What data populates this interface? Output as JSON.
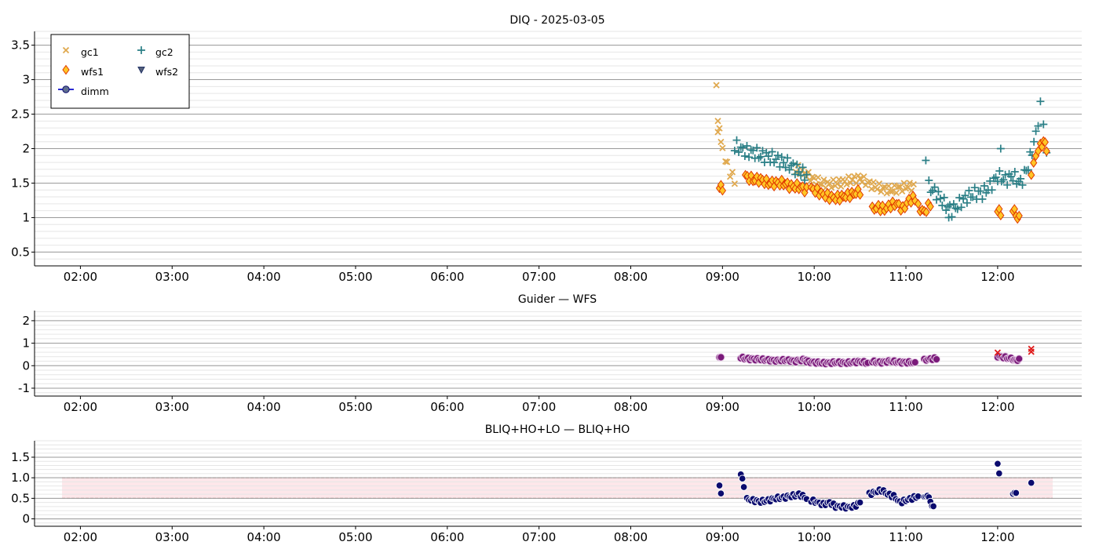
{
  "figure": {
    "colors": {
      "gc1": "#e0a94f",
      "gc2": "#2a7f86",
      "wfs1_fill": "#ffc626",
      "wfs1_edge": "#e03a00",
      "wfs2": "#223366",
      "dimm": "#0b0b6e",
      "guider": "#7a1a7a",
      "guider_alert": "#e01b1b",
      "band": "#fde7ea",
      "band_line": "#a31414"
    }
  },
  "chart_data": [
    {
      "type": "scatter",
      "title": "DIQ - 2025-03-05",
      "x_ticks": [
        "02:00",
        "03:00",
        "04:00",
        "05:00",
        "06:00",
        "07:00",
        "08:00",
        "09:00",
        "10:00",
        "11:00",
        "12:00"
      ],
      "y_ticks": [
        "0.5",
        "1",
        "1.5",
        "2",
        "2.5",
        "3",
        "3.5"
      ],
      "xlim": [
        "01:30",
        "12:55"
      ],
      "ylim": [
        0.3,
        3.7
      ],
      "grid": true,
      "legend": {
        "placement": "top-left",
        "entries": [
          "gc1",
          "gc2",
          "wfs1",
          "wfs2",
          "dimm"
        ]
      },
      "series": [
        {
          "name": "gc1",
          "marker": "x",
          "segments": [
            {
              "x": [
                "08:57",
                "08:58",
                "08:59",
                "09:00",
                "09:02",
                "09:03",
                "09:05",
                "09:08"
              ],
              "y": [
                2.2,
                2.35,
                2.1,
                1.95,
                1.85,
                1.75,
                1.65,
                1.55
              ]
            },
            {
              "x": [
                "09:48",
                "09:55",
                "10:00",
                "10:05",
                "10:10",
                "10:15",
                "10:20",
                "10:25",
                "10:30",
                "10:35",
                "10:40",
                "10:45",
                "10:50",
                "10:55",
                "11:00",
                "11:05"
              ],
              "y": [
                1.72,
                1.62,
                1.55,
                1.5,
                1.48,
                1.5,
                1.52,
                1.55,
                1.57,
                1.5,
                1.45,
                1.42,
                1.4,
                1.42,
                1.45,
                1.45
              ]
            }
          ],
          "points": [
            {
              "x": "08:56",
              "y": 2.92
            },
            {
              "x": "08:57",
              "y": 2.4
            }
          ]
        },
        {
          "name": "gc2",
          "marker": "+",
          "segments": [
            {
              "x": [
                "09:08",
                "09:12",
                "09:16",
                "09:20",
                "09:25",
                "09:30",
                "09:35",
                "09:40",
                "09:45",
                "09:50",
                "09:55"
              ],
              "y": [
                2.05,
                2.0,
                1.95,
                1.95,
                1.9,
                1.88,
                1.85,
                1.8,
                1.75,
                1.68,
                1.6
              ]
            },
            {
              "x": [
                "11:15",
                "11:20",
                "11:25",
                "11:30",
                "11:35",
                "11:40",
                "11:45",
                "11:50",
                "11:55",
                "12:00",
                "12:05",
                "12:10",
                "12:15",
                "12:20",
                "12:25",
                "12:28",
                "12:30",
                "12:32"
              ],
              "y": [
                1.45,
                1.35,
                1.2,
                1.1,
                1.2,
                1.3,
                1.35,
                1.35,
                1.45,
                1.6,
                1.55,
                1.6,
                1.5,
                1.75,
                2.2,
                2.6,
                2.4,
                1.95
              ]
            }
          ],
          "points": [
            {
              "x": "11:13",
              "y": 1.83
            },
            {
              "x": "12:02",
              "y": 2.0
            },
            {
              "x": "11:28",
              "y": 1.0
            }
          ]
        },
        {
          "name": "wfs1",
          "marker": "diamond",
          "segments": [
            {
              "x": [
                "08:58",
                "09:00"
              ],
              "y": [
                1.45,
                1.4
              ]
            },
            {
              "x": [
                "09:15",
                "09:20",
                "09:25",
                "09:30",
                "09:35",
                "09:40",
                "09:45",
                "09:50",
                "09:55"
              ],
              "y": [
                1.6,
                1.55,
                1.55,
                1.5,
                1.5,
                1.5,
                1.45,
                1.45,
                1.4
              ]
            },
            {
              "x": [
                "09:58",
                "10:02",
                "10:06",
                "10:10",
                "10:14",
                "10:18",
                "10:22",
                "10:26",
                "10:30"
              ],
              "y": [
                1.42,
                1.38,
                1.33,
                1.3,
                1.28,
                1.3,
                1.32,
                1.35,
                1.38
              ]
            },
            {
              "x": [
                "10:38",
                "10:42",
                "10:46",
                "10:50",
                "10:54",
                "10:58",
                "11:02",
                "11:06"
              ],
              "y": [
                1.12,
                1.15,
                1.12,
                1.18,
                1.2,
                1.12,
                1.25,
                1.28
              ]
            },
            {
              "x": [
                "11:08",
                "11:12",
                "11:16"
              ],
              "y": [
                1.15,
                1.08,
                1.2
              ]
            },
            {
              "x": [
                "12:00",
                "12:02"
              ],
              "y": [
                1.1,
                1.05
              ]
            },
            {
              "x": [
                "12:10",
                "12:12",
                "12:14"
              ],
              "y": [
                1.1,
                1.05,
                0.98
              ]
            },
            {
              "x": [
                "12:22",
                "12:25",
                "12:28",
                "12:30",
                "12:32"
              ],
              "y": [
                1.65,
                1.9,
                2.05,
                2.1,
                2.0
              ]
            }
          ],
          "points": []
        },
        {
          "name": "wfs2",
          "marker": "triangle-down",
          "segments": [],
          "points": []
        },
        {
          "name": "dimm",
          "marker": "circle-line",
          "segments": [],
          "points": []
        }
      ]
    },
    {
      "type": "scatter",
      "title": "Guider — WFS",
      "x_ticks": [
        "02:00",
        "03:00",
        "04:00",
        "05:00",
        "06:00",
        "07:00",
        "08:00",
        "09:00",
        "10:00",
        "11:00",
        "12:00"
      ],
      "y_ticks": [
        "-1",
        "0",
        "1",
        "2"
      ],
      "xlim": [
        "01:30",
        "12:55"
      ],
      "ylim": [
        -1.35,
        2.45
      ],
      "grid": true,
      "series": [
        {
          "marker": "circle",
          "segments": [
            {
              "x": [
                "08:58",
                "08:59"
              ],
              "y": [
                0.42,
                0.38
              ]
            },
            {
              "x": [
                "09:12",
                "09:18",
                "09:24",
                "09:30",
                "09:36",
                "09:42",
                "09:48",
                "09:55"
              ],
              "y": [
                0.35,
                0.3,
                0.28,
                0.25,
                0.22,
                0.25,
                0.2,
                0.28
              ]
            },
            {
              "x": [
                "09:55",
                "10:00",
                "10:05",
                "10:10",
                "10:15",
                "10:20",
                "10:25",
                "10:30",
                "10:35"
              ],
              "y": [
                0.18,
                0.15,
                0.12,
                0.12,
                0.15,
                0.12,
                0.15,
                0.18,
                0.12
              ]
            },
            {
              "x": [
                "10:38",
                "10:44",
                "10:50",
                "10:56",
                "11:02",
                "11:06"
              ],
              "y": [
                0.18,
                0.15,
                0.2,
                0.15,
                0.15,
                0.12
              ]
            },
            {
              "x": [
                "11:12",
                "11:16",
                "11:20"
              ],
              "y": [
                0.25,
                0.3,
                0.32
              ]
            },
            {
              "x": [
                "12:00",
                "12:10",
                "12:12",
                "12:14"
              ],
              "y": [
                0.42,
                0.3,
                0.2,
                0.32
              ]
            }
          ]
        },
        {
          "marker": "x",
          "points": [
            {
              "x": "12:00",
              "y": 0.58
            },
            {
              "x": "12:22",
              "y": 0.75
            },
            {
              "x": "12:22",
              "y": 0.62
            }
          ]
        }
      ]
    },
    {
      "type": "scatter",
      "title": "BLIQ+HO+LO — BLIQ+HO",
      "x_ticks": [
        "02:00",
        "03:00",
        "04:00",
        "05:00",
        "06:00",
        "07:00",
        "08:00",
        "09:00",
        "10:00",
        "11:00",
        "12:00"
      ],
      "y_ticks": [
        "0",
        "0.5",
        "1.0",
        "1.5"
      ],
      "xlim": [
        "01:30",
        "12:55"
      ],
      "ylim": [
        -0.18,
        1.9
      ],
      "grid": true,
      "band": {
        "xmin": "01:48",
        "xmax": "12:36",
        "ymin": 0.5,
        "ymax": 1.0
      },
      "series": [
        {
          "marker": "circle",
          "segments": [
            {
              "x": [
                "08:58",
                "08:59"
              ],
              "y": [
                0.85,
                0.62
              ]
            },
            {
              "x": [
                "09:12",
                "09:14"
              ],
              "y": [
                1.1,
                0.78
              ]
            },
            {
              "x": [
                "09:16",
                "09:20",
                "09:25",
                "09:30",
                "09:35",
                "09:40",
                "09:45",
                "09:50",
                "09:55"
              ],
              "y": [
                0.48,
                0.45,
                0.42,
                0.45,
                0.5,
                0.52,
                0.55,
                0.6,
                0.5
              ]
            },
            {
              "x": [
                "09:58",
                "10:02",
                "10:06",
                "10:10",
                "10:14",
                "10:18",
                "10:22",
                "10:26",
                "10:30"
              ],
              "y": [
                0.45,
                0.4,
                0.35,
                0.4,
                0.3,
                0.3,
                0.28,
                0.3,
                0.4
              ]
            },
            {
              "x": [
                "10:36",
                "10:40",
                "10:44",
                "10:48",
                "10:52",
                "10:56",
                "11:00",
                "11:04",
                "11:08"
              ],
              "y": [
                0.6,
                0.65,
                0.7,
                0.6,
                0.55,
                0.4,
                0.45,
                0.5,
                0.55
              ]
            },
            {
              "x": [
                "11:12",
                "11:14",
                "11:16",
                "11:18"
              ],
              "y": [
                0.5,
                0.6,
                0.4,
                0.3
              ]
            },
            {
              "x": [
                "12:00",
                "12:01"
              ],
              "y": [
                1.38,
                1.1
              ]
            },
            {
              "x": [
                "12:10",
                "12:12"
              ],
              "y": [
                0.65,
                0.6
              ]
            },
            {
              "x": [
                "12:22"
              ],
              "y": [
                0.85
              ]
            }
          ]
        }
      ]
    }
  ]
}
